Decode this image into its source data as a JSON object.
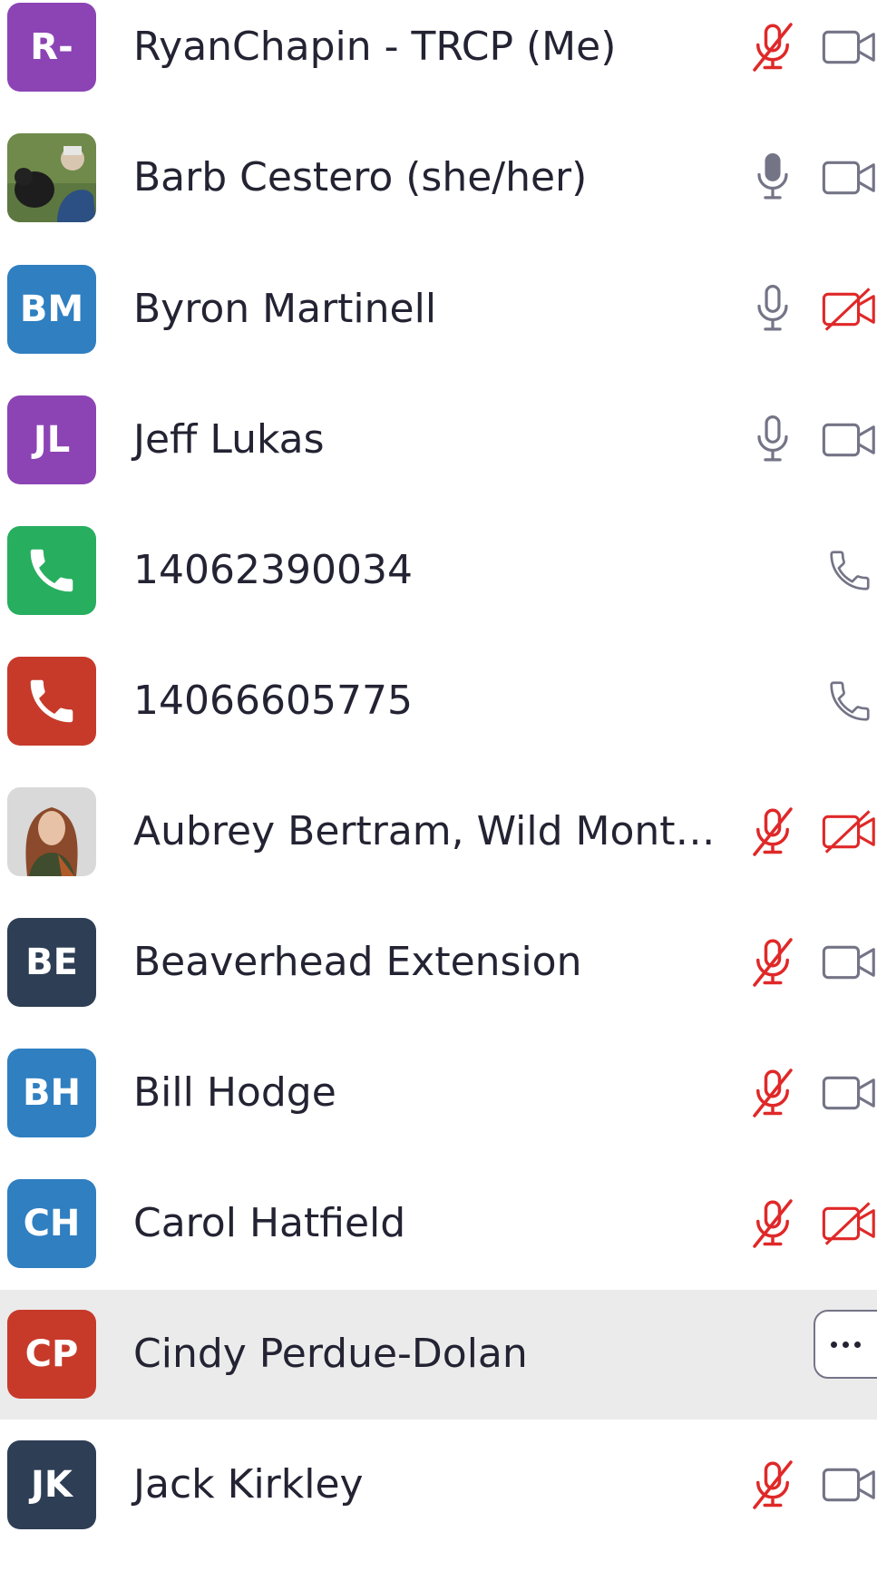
{
  "participants": [
    {
      "name": "RyanChapin - TRCP (Me)",
      "initials": "R-",
      "avatar_color": "#8c44b5",
      "mic": "muted",
      "video": "on"
    },
    {
      "name": "Barb Cestero (she/her)",
      "avatar_photo": "person-with-dog-photo",
      "mic": "on",
      "video": "on"
    },
    {
      "name": "Byron Martinell",
      "initials": "BM",
      "avatar_color": "#2f7fc1",
      "mic": "on",
      "video": "off"
    },
    {
      "name": "Jeff Lukas",
      "initials": "JL",
      "avatar_color": "#8c44b5",
      "mic": "on",
      "video": "on"
    },
    {
      "name": "14062390034",
      "avatar_icon": "phone-icon",
      "avatar_color": "#27ae5f",
      "type": "phone"
    },
    {
      "name": "14066605775",
      "avatar_icon": "phone-icon",
      "avatar_color": "#c73a2a",
      "type": "phone"
    },
    {
      "name": "Aubrey Bertram, Wild Montana...",
      "avatar_photo": "woman-portrait-photo",
      "mic": "muted",
      "video": "off"
    },
    {
      "name": "Beaverhead Extension",
      "initials": "BE",
      "avatar_color": "#2e3e55",
      "mic": "muted",
      "video": "on"
    },
    {
      "name": "Bill Hodge",
      "initials": "BH",
      "avatar_color": "#2f7fc1",
      "mic": "muted",
      "video": "on"
    },
    {
      "name": "Carol Hatfield",
      "initials": "CH",
      "avatar_color": "#2f7fc1",
      "mic": "muted",
      "video": "off"
    },
    {
      "name": "Cindy Perdue-Dolan",
      "initials": "CP",
      "avatar_color": "#c73a2a",
      "highlighted": true,
      "more_button": "more-options-icon"
    },
    {
      "name": "Jack Kirkley",
      "initials": "JK",
      "avatar_color": "#2e3e55",
      "mic": "muted",
      "video": "on"
    }
  ],
  "colors": {
    "muted": "#e02828",
    "icon_gray": "#747487",
    "highlight_bg": "#ebebeb",
    "text": "#232333"
  }
}
